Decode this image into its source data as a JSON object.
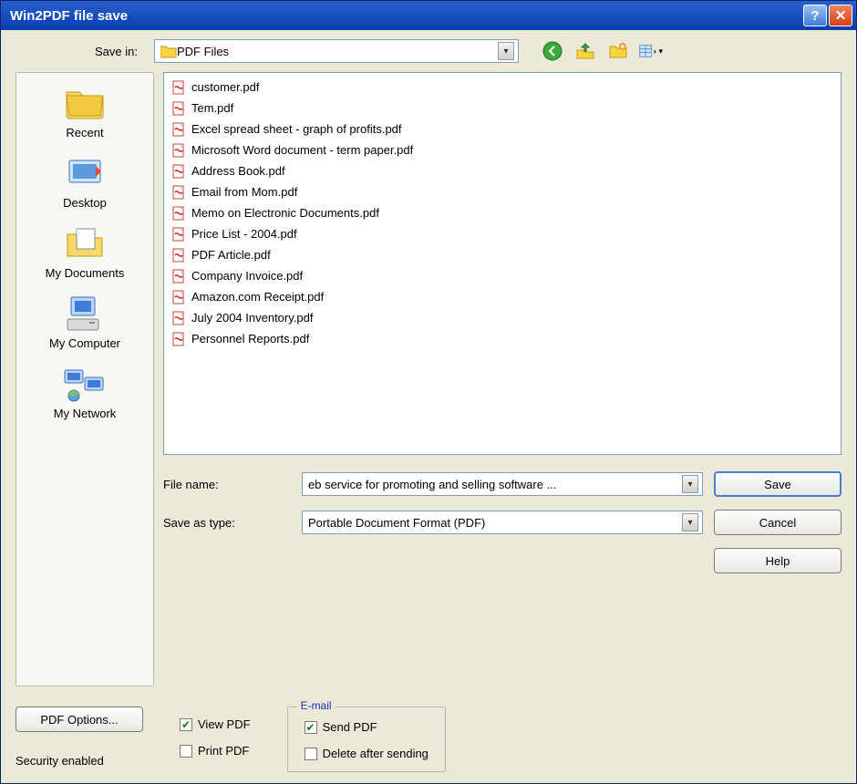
{
  "window": {
    "title": "Win2PDF file save"
  },
  "savein": {
    "label": "Save in:",
    "value": "PDF Files"
  },
  "toolbar": {
    "back": "back-icon",
    "up": "up-one-level-icon",
    "newfolder": "new-folder-icon",
    "views": "views-icon"
  },
  "places": [
    {
      "name": "recent",
      "label": "Recent"
    },
    {
      "name": "desktop",
      "label": "Desktop"
    },
    {
      "name": "mydocs",
      "label": "My Documents"
    },
    {
      "name": "mycomputer",
      "label": "My Computer"
    },
    {
      "name": "mynetwork",
      "label": "My Network"
    }
  ],
  "files": [
    "customer.pdf",
    "Tem.pdf",
    "Excel spread sheet - graph of profits.pdf",
    "Microsoft Word document - term paper.pdf",
    "Address Book.pdf",
    "Email from Mom.pdf",
    "Memo on Electronic Documents.pdf",
    "Price List - 2004.pdf",
    "PDF Article.pdf",
    "Company Invoice.pdf",
    "Amazon.com Receipt.pdf",
    "July 2004 Inventory.pdf",
    "Personnel Reports.pdf"
  ],
  "form": {
    "filename_label": "File name:",
    "filename_value": "eb service for promoting and selling software ...",
    "saveas_label": "Save as type:",
    "saveas_value": "Portable Document Format (PDF)"
  },
  "buttons": {
    "save": "Save",
    "cancel": "Cancel",
    "help": "Help",
    "pdf_options": "PDF Options..."
  },
  "checks": {
    "view_pdf": {
      "label": "View PDF",
      "checked": true
    },
    "print_pdf": {
      "label": "Print PDF",
      "checked": false
    }
  },
  "email_group": {
    "legend": "E-mail",
    "send_pdf": {
      "label": "Send PDF",
      "checked": true
    },
    "delete_after": {
      "label": "Delete after sending",
      "checked": false
    }
  },
  "security_text": "Security enabled"
}
